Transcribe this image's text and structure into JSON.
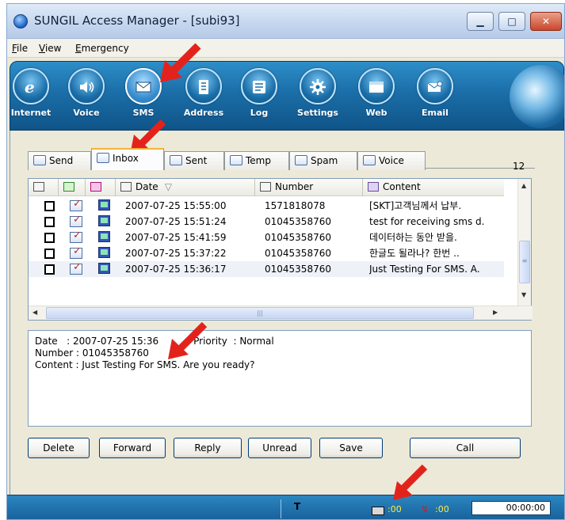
{
  "window": {
    "title": "SUNGIL Access Manager - [subi93]",
    "controls": {
      "minimize": "▁",
      "maximize": "□",
      "close": "✕"
    }
  },
  "menu": [
    {
      "label": "File",
      "mnemonic": "F",
      "rest": "ile"
    },
    {
      "label": "View",
      "mnemonic": "V",
      "rest": "iew"
    },
    {
      "label": "Emergency",
      "mnemonic": "E",
      "rest": "mergency"
    }
  ],
  "toolbar": [
    {
      "label": "Internet",
      "icon": "internet-explorer-icon"
    },
    {
      "label": "Voice",
      "icon": "speaker-icon"
    },
    {
      "label": "SMS",
      "icon": "envelope-icon"
    },
    {
      "label": "Address",
      "icon": "address-book-icon"
    },
    {
      "label": "Log",
      "icon": "log-list-icon"
    },
    {
      "label": "Settings",
      "icon": "gear-icon"
    },
    {
      "label": "Web",
      "icon": "web-window-icon"
    },
    {
      "label": "Email",
      "icon": "email-icon"
    }
  ],
  "tabs": [
    {
      "label": "Send",
      "active": false
    },
    {
      "label": "Inbox",
      "active": true
    },
    {
      "label": "Sent",
      "active": false
    },
    {
      "label": "Temp",
      "active": false
    },
    {
      "label": "Spam",
      "active": false
    },
    {
      "label": "Voice",
      "active": false
    }
  ],
  "message_count": "12",
  "list": {
    "columns": {
      "date": "Date",
      "number": "Number",
      "content": "Content"
    },
    "rows": [
      {
        "date": "2007-07-25 15:55:00",
        "number": "1571818078",
        "content": "[SKT]고객님께서 납부."
      },
      {
        "date": "2007-07-25 15:51:24",
        "number": "01045358760",
        "content": "test for receiving sms d."
      },
      {
        "date": "2007-07-25 15:41:59",
        "number": "01045358760",
        "content": "데이터하는 동안 받을."
      },
      {
        "date": "2007-07-25 15:37:22",
        "number": "01045358760",
        "content": "한글도 될라나? 한번 .."
      },
      {
        "date": "2007-07-25 15:36:17",
        "number": "01045358760",
        "content": "Just Testing For SMS. A."
      }
    ]
  },
  "detail": {
    "date_line": "Date   : 2007-07-25 15:36",
    "priority_line": "Priority  : Normal",
    "number_line": "Number : 01045358760",
    "content_line": "Content : Just Testing For SMS. Are you ready?"
  },
  "buttons": {
    "delete": "Delete",
    "forward": "Forward",
    "reply": "Reply",
    "unread": "Unread",
    "save": "Save",
    "call": "Call"
  },
  "status": {
    "sms_count": ":00",
    "call_count": ":00",
    "timer": "00:00:00"
  },
  "colors": {
    "toolbar_blue": "#1b6ea8",
    "annotation_red": "#e3231b",
    "active_tab_border": "#f7b23c",
    "status_text": "#ffef3a"
  }
}
